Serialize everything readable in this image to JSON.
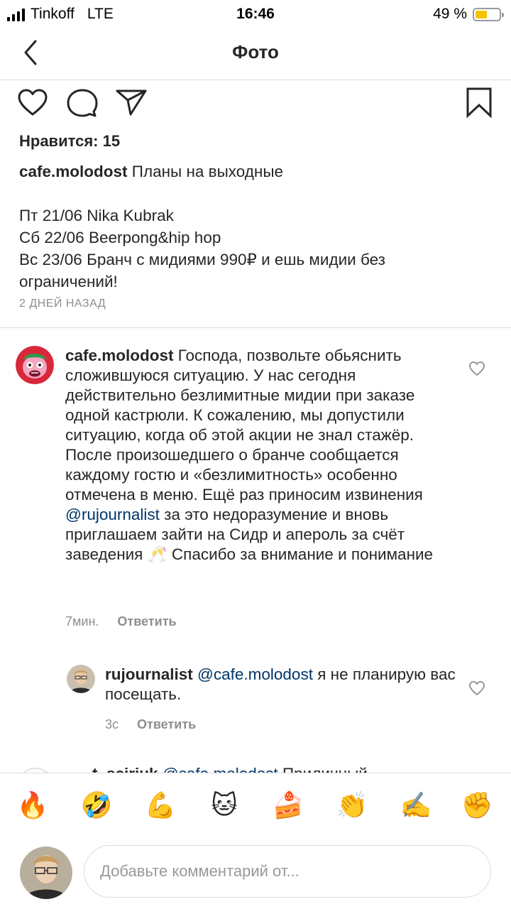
{
  "status": {
    "carrier": "Tinkoff",
    "network": "LTE",
    "time": "16:46",
    "battery_text": "49 %",
    "battery_level": 0.49
  },
  "nav": {
    "title": "Фото",
    "back_icon": "chevron-left-icon"
  },
  "post": {
    "likes": "Нравится: 15",
    "caption_user": "cafe.molodost",
    "caption_title": "Планы на выходные",
    "schedule": [
      "Пт 21/06  Nika Kubrak",
      "Сб 22/06 Beerpong&hip hop",
      "Вс 23/06 Бранч с мидиями 990₽ и ешь мидии без ограничений!"
    ],
    "time_ago": "2 ДНЕЙ НАЗАД"
  },
  "comments": [
    {
      "user": "cafe.molodost",
      "text_before": "Господа, позвольте обьяснить сложившуюся ситуацию. У нас сегодня действительно безлимитные мидии при заказе одной кастрюли. К сожалению, мы допустили  ситуацию, когда об этой акции не знал стажёр. После произошедшего о бранче сообщается каждому гостю и «безлимитность» особенно отмечена в меню. Ещё раз приносим извинения ",
      "mention": "@rujournalist",
      "text_after": " за это недоразумение и вновь приглашаем зайти на Сидр и апероль за счёт заведения 🥂 Спасибо за внимание и понимание",
      "time": "7мин.",
      "reply_label": "Ответить"
    },
    {
      "user": "rujournalist",
      "mention": "@cafe.molodost",
      "text_after": " я не планирую вас посещать.",
      "time": "3с",
      "reply_label": "Ответить"
    }
  ],
  "partial_comment": {
    "user": "t_sciriuk",
    "mention": "@cafe.molodost",
    "text": " Приличный"
  },
  "emoji_bar": [
    "🔥",
    "🤣",
    "💪",
    "🐱",
    "🍰",
    "👏",
    "✍️",
    "✊"
  ],
  "composer": {
    "placeholder": "Добавьте комментарий от..."
  },
  "colors": {
    "text": "#262626",
    "secondary": "#8e8e8e",
    "mention": "#003569",
    "divider": "#dbdbdb",
    "battery": "#f5c400"
  }
}
